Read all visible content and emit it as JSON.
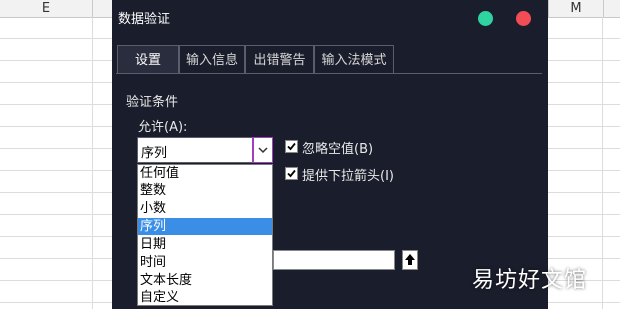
{
  "spreadsheet": {
    "columns": [
      "E",
      "M"
    ]
  },
  "dialog": {
    "title": "数据验证",
    "tabs": [
      {
        "label": "设置",
        "active": true
      },
      {
        "label": "输入信息",
        "active": false
      },
      {
        "label": "出错警告",
        "active": false
      },
      {
        "label": "输入法模式",
        "active": false
      }
    ],
    "section_title": "验证条件",
    "allow_label": "允许(A):",
    "allow_value": "序列",
    "ignore_blank": {
      "label": "忽略空值(B)",
      "checked": true
    },
    "in_cell_dropdown": {
      "label": "提供下拉箭头(I)",
      "checked": true
    },
    "allow_options": [
      "任何值",
      "整数",
      "小数",
      "序列",
      "日期",
      "时间",
      "文本长度",
      "自定义"
    ],
    "selected_option": "序列"
  },
  "watermark": "易坊好文馆",
  "colors": {
    "dialog_bg": "#1a1d2b",
    "selection": "#3a8ee6",
    "close_dot": "#f24d55",
    "max_dot": "#2ed3a0"
  }
}
